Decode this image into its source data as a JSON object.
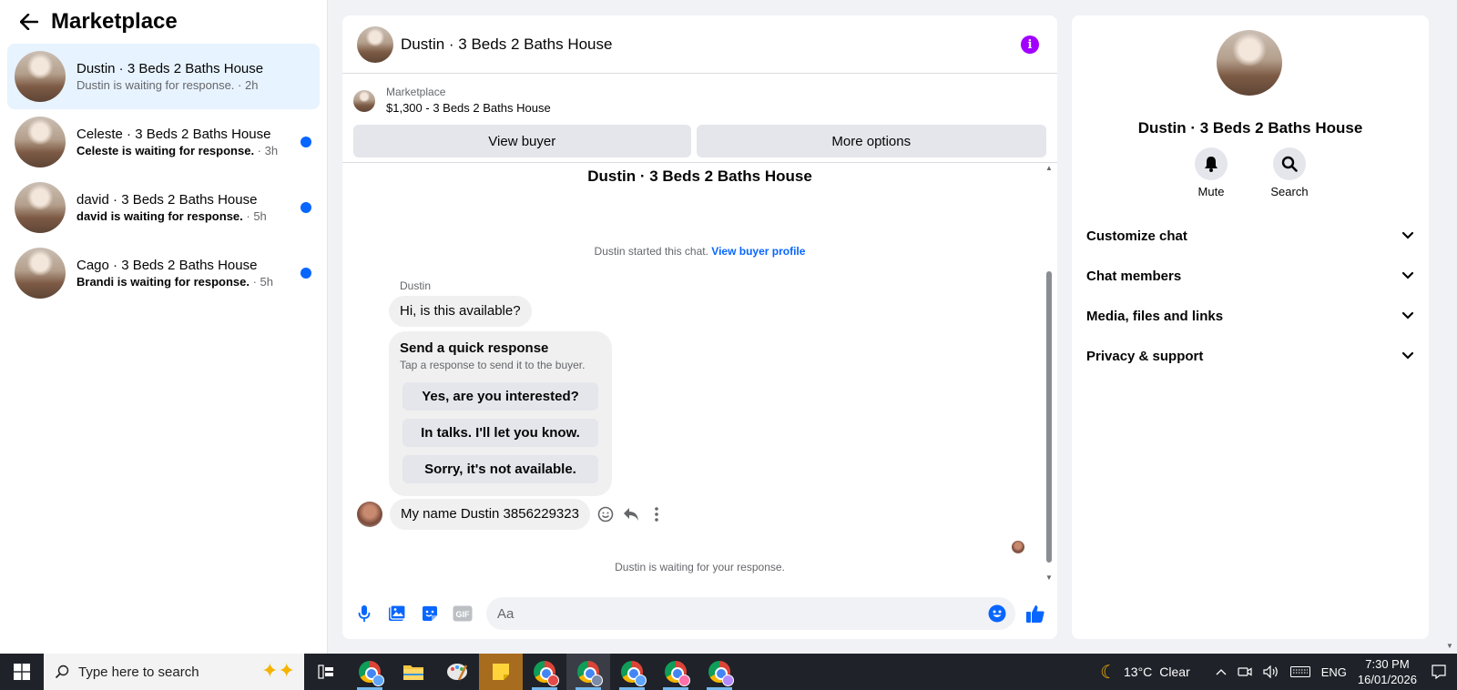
{
  "sidebar": {
    "title": "Marketplace",
    "conversations": [
      {
        "title": "Dustin · 3 Beds 2 Baths House",
        "preview": "Dustin is waiting for response.",
        "time": " · 2h",
        "active": true,
        "unread": false
      },
      {
        "title": "Celeste · 3 Beds 2 Baths House",
        "preview": "Celeste is waiting for response.",
        "time": " · 3h",
        "active": false,
        "unread": true
      },
      {
        "title": "david · 3 Beds 2 Baths House",
        "preview": "david is waiting for response.",
        "time": " · 5h",
        "active": false,
        "unread": true
      },
      {
        "title": "Cago · 3 Beds 2 Baths House",
        "preview": "Brandi is waiting for response.",
        "time": " · 5h",
        "active": false,
        "unread": true
      }
    ]
  },
  "chat": {
    "title": "Dustin · 3 Beds 2 Baths House",
    "listing": {
      "source": "Marketplace",
      "item": "$1,300 - 3 Beds 2 Baths House",
      "view_buyer": "View buyer",
      "more_options": "More options"
    },
    "conversation_title": "Dustin · 3 Beds 2 Baths House",
    "started_text": "Dustin started this chat.",
    "started_link": "View buyer profile",
    "sender_name": "Dustin",
    "message1": "Hi, is this available?",
    "quick_response": {
      "heading": "Send a quick response",
      "subtext": "Tap a response to send it to the buyer.",
      "options": [
        "Yes, are you interested?",
        "In talks. I'll let you know.",
        "Sorry, it's not available."
      ]
    },
    "message2": "My name Dustin 3856229323",
    "waiting": "Dustin is waiting for your response.",
    "composer_placeholder": "Aa"
  },
  "info_panel": {
    "name": "Dustin · 3 Beds 2 Baths House",
    "actions": [
      {
        "label": "Mute",
        "icon": "bell-icon"
      },
      {
        "label": "Search",
        "icon": "search-icon"
      }
    ],
    "sections": [
      "Customize chat",
      "Chat members",
      "Media, files and links",
      "Privacy & support"
    ]
  },
  "taskbar": {
    "search_placeholder": "Type here to search",
    "weather": {
      "temp": "13°C",
      "condition": "Clear"
    },
    "lang": "ENG",
    "time": "7:30 PM",
    "date": "16/01/2026"
  },
  "colors": {
    "accent": "#0866ff",
    "info": "#a100ff",
    "active_bg": "#e7f3ff"
  }
}
